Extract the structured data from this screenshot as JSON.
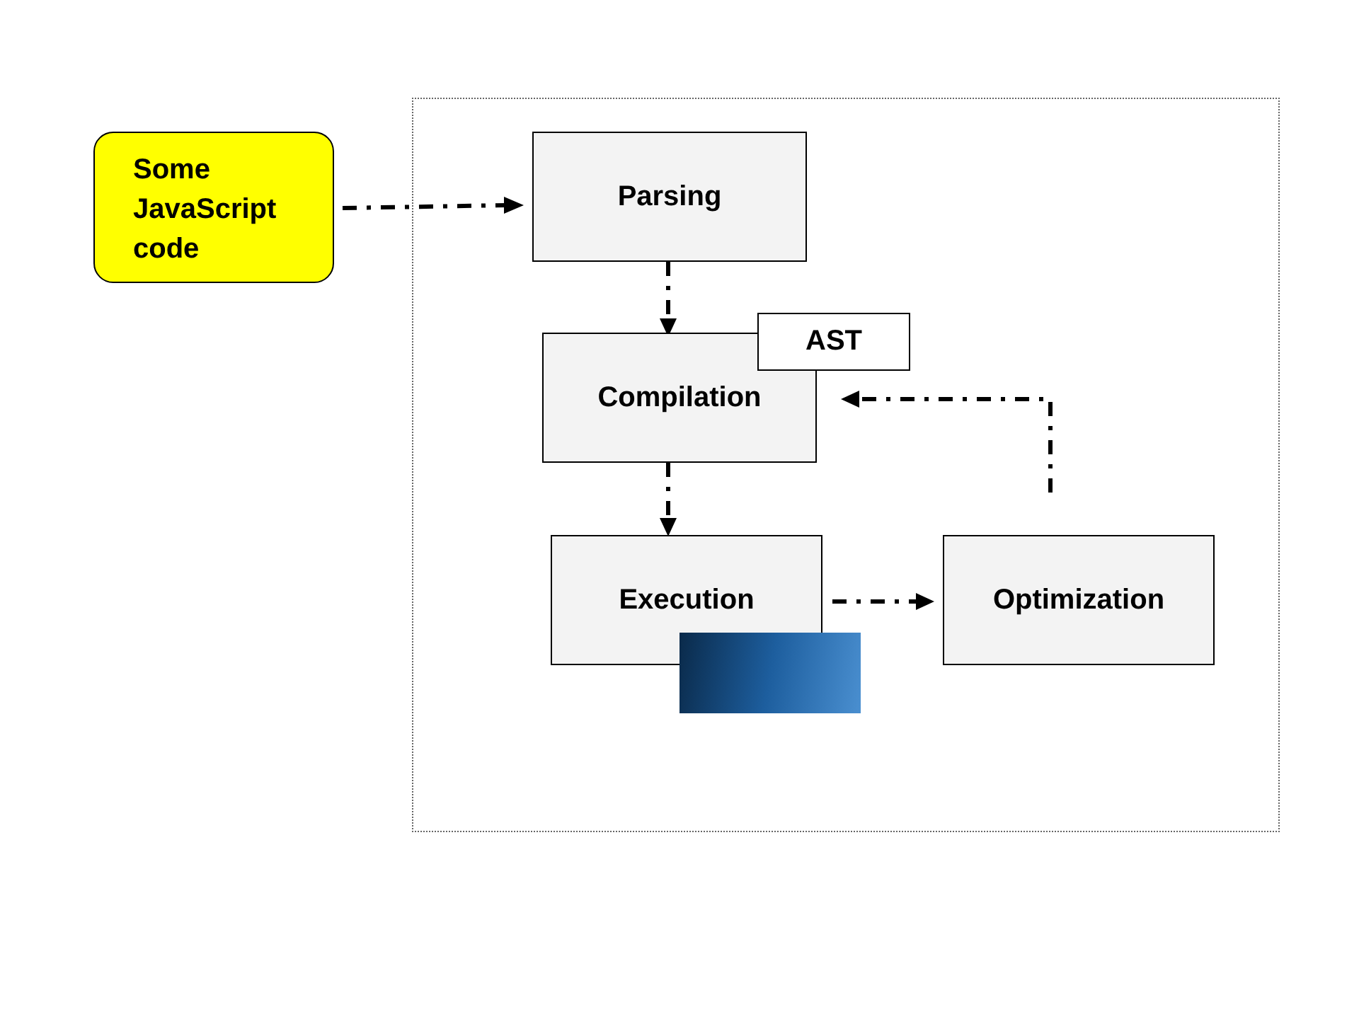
{
  "input": {
    "label": "Some JavaScript code"
  },
  "stages": [
    {
      "label": "Parsing"
    },
    {
      "label": "Compilation"
    },
    {
      "label": "Execution"
    },
    {
      "label": "Optimization"
    }
  ],
  "ast_label": "AST"
}
